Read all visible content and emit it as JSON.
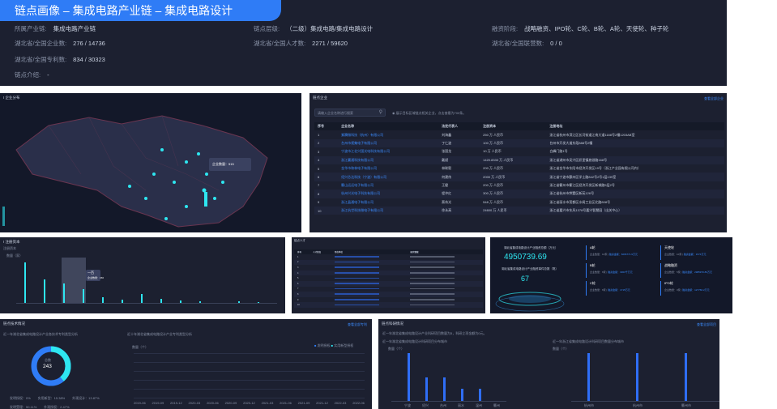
{
  "page": {
    "title": "链点画像 – 集成电路产业链 – 集成电路设计"
  },
  "info": {
    "fields": [
      {
        "label": "所属产业链:",
        "value": "集成电路产业链"
      },
      {
        "label": "链点层级:",
        "value": "（二级）集成电路/集成电路设计"
      },
      {
        "label": "融资阶段:",
        "value": "战略融资、IPO轮、C轮、B轮、A轮、天使轮、种子轮"
      },
      {
        "label": "湖北省/全国企业数:",
        "value": "276 / 14736"
      },
      {
        "label": "湖北省/全国人才数:",
        "value": "2271 / 59620"
      },
      {
        "label": "湖北省/全国联营数:",
        "value": "0 / 0"
      },
      {
        "label": "湖北省/全国专利数:",
        "value": "834 / 30323"
      },
      {
        "label": "链点介绍:",
        "value": "-"
      }
    ]
  },
  "map": {
    "title": "I 企业分布",
    "tooltip": "企业数量：515",
    "legend": [
      "0",
      "100",
      "250"
    ]
  },
  "enterprises": {
    "title": "链点企业",
    "more": "查看全部企业",
    "search_placeholder": "请输入企业名称进行搜索",
    "filter": "展示目标区域链点相关企业，点击查看为700条。",
    "columns": [
      "序号",
      "企业名称",
      "法定代表人",
      "注册资本",
      "注册地址"
    ],
    "rows": [
      [
        "1",
        "紫腾微科技（杭州）有限公司",
        "刘海鑫",
        "250 万 人民币",
        "浙江省杭州市滨江区长河街道江南大道1188号2幢1203AB室"
      ],
      [
        "2",
        "台州市视集电子有限公司",
        "丁仁波",
        "100 万 人民币",
        "台州市开发大道东段888号2幢"
      ],
      [
        "3",
        "宁波市江北兴国光电科技有限公司",
        "张国龙",
        "10 万 人民币",
        "白峰门路1号"
      ],
      [
        "4",
        "浙江赢通科技有限公司",
        "戴斌",
        "1420.8333 万 人民币",
        "浙江省湖州市吴兴区织里镇旅游路168号"
      ],
      [
        "5",
        "金华市和林电子有限公司",
        "林联毅",
        "200 万 人民币",
        "浙江省金华市东阳市经济开发区19号（浙江产业园有限公司内）"
      ],
      [
        "6",
        "绍兴芯达科技（宁波）有限公司",
        "何建伟",
        "2000 万 人民币",
        "浙江省宁波市鄞州区学士路842号2号1层139室"
      ],
      [
        "7",
        "衢山远远电子有限公司",
        "王健",
        "200 万 人民币",
        "浙江省衢州市衢江区经济开发区新城路5层2号"
      ],
      [
        "8",
        "杭州兴光电子科技有限公司",
        "程冲红",
        "300 万 人民币",
        "浙江省杭州市拱墅区新苑126号"
      ],
      [
        "9",
        "浙江晶通电子有限公司",
        "蔡伟光",
        "548 万 人民币",
        "浙江省丽水市莲都区水阁工业区北路808号"
      ],
      [
        "10",
        "浙江杭世科技微电子有限公司",
        "徐永高",
        "24600 万 人民币",
        "浙江省嘉兴市东风1378号嘉兴智慧园（出关中心）"
      ]
    ]
  },
  "reg": {
    "title": "I 注册资本",
    "sub": "注册资本",
    "unit": "数量（家）",
    "tooltip_title": "一百",
    "tooltip_value": "企业数量：150"
  },
  "talent": {
    "title": "链点人才",
    "columns": [
      "序号",
      "人才姓名",
      "所在单位",
      "研究领域"
    ],
    "rows": [
      "1",
      "2",
      "3",
      "4",
      "5",
      "6",
      "7",
      "8",
      "9",
      "10"
    ]
  },
  "invest": {
    "label1": "湖北省集成电路设计产业融资总额（万元）",
    "total": "4950739.69",
    "label2": "湖北省集成电路设计产业融资事件总数（笔）",
    "count": "67",
    "rounds": [
      {
        "name": "A轮",
        "a": "企业数量：10家",
        "b": "融资金额：6096771.9万元"
      },
      {
        "name": "天使轮",
        "a": "企业数量：10家",
        "b": "融资金额：1574万元"
      },
      {
        "name": "B轮",
        "a": "企业数量：6家",
        "b": "融资金额：3303千万元"
      },
      {
        "name": "战略融资",
        "a": "企业数量：5家",
        "b": "融资金额：2985970.83万元"
      },
      {
        "name": "C轮",
        "a": "企业数量：6家",
        "b": "融资金额：1715万元"
      },
      {
        "name": "IPO轮",
        "a": "企业数量：3家",
        "b": "融资金额：127766.2万元"
      }
    ]
  },
  "tech": {
    "title": "链点技术情况",
    "more": "查看全部专利",
    "sub1": "近一年湖北省集成电路设计产业各技术专利类型分析",
    "sub2": "近十年湖北省集成电路设计产业专利类型分析",
    "donut_label": "总数",
    "donut_value": "243",
    "legend": [
      "发明授权：0%",
      "实用新型：15.38%",
      "外观设计：13.87%",
      "发明受理：50.11%",
      "外观授权：2.47%"
    ],
    "chart_legend": [
      "发明授权",
      "实用新型授权"
    ],
    "yunit": "数量（个）",
    "xlabels": [
      "2019-06",
      "2019-09",
      "2019-12",
      "2020-03",
      "2020-06",
      "2020-09",
      "2020-12",
      "2021-03",
      "2021-06",
      "2021-09",
      "2021-12",
      "2022-03",
      "2022-06"
    ]
  },
  "demand": {
    "title": "链点科研情况",
    "more": "查看全部项目",
    "note": "近一年湖北省集成电路设计产业科研项目数量为5，科研立项金额为0元。",
    "sub1": "近一年湖北省集成电路设计科研项目分布城市",
    "sub2": "近一年浙江省集成电路设计科研项目数量分布城市",
    "yunit": "数量（个）",
    "x1": [
      "宁波",
      "绍兴",
      "台州",
      "丽水",
      "温州",
      "衢州"
    ],
    "x2": [
      "杭州市",
      "杭州市",
      "衢州市"
    ]
  },
  "chart_data": [
    {
      "type": "bar",
      "title": "注册资本",
      "ylabel": "数量（家）",
      "series": [
        {
          "values": [
            122,
            70,
            58,
            42,
            18,
            9,
            26,
            12,
            7,
            5,
            1,
            4,
            2
          ]
        }
      ],
      "ylim": [
        0,
        150
      ]
    },
    {
      "type": "pie",
      "categories": [
        "发明授权",
        "实用新型",
        "外观设计",
        "发明受理",
        "外观授权"
      ],
      "values": [
        0,
        15.38,
        13.87,
        50.11,
        2.47
      ]
    },
    {
      "type": "bar",
      "title": "近一年湖北省集成电路设计科研项目分布城市",
      "categories": [
        "宁波",
        "绍兴",
        "台州",
        "丽水",
        "温州",
        "衢州"
      ],
      "values": [
        4,
        2,
        2,
        1,
        1,
        0
      ],
      "ylim": [
        0,
        4
      ]
    },
    {
      "type": "bar",
      "title": "近一年浙江省集成电路设计科研项目数量分布城市",
      "categories": [
        "杭州市",
        "杭州市",
        "衢州市"
      ],
      "values": [
        1,
        1,
        1
      ],
      "ylim": [
        0,
        1
      ]
    }
  ]
}
